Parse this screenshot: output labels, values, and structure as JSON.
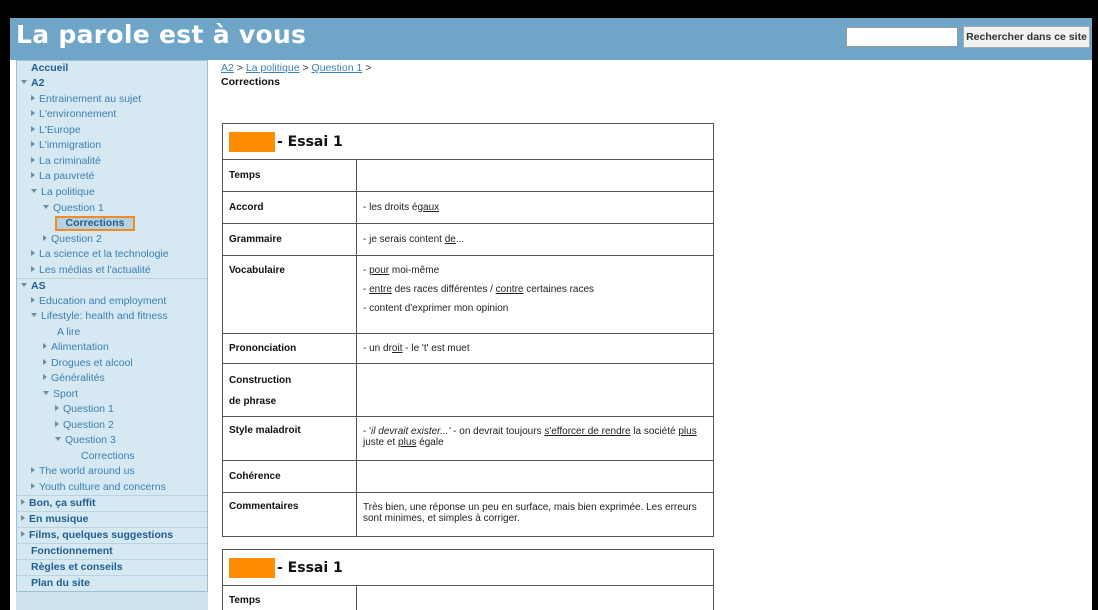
{
  "header": {
    "title": "La parole est à vous",
    "search_button": "Rechercher dans ce site",
    "search_value": ""
  },
  "sidebar": {
    "items": [
      {
        "label": "Accueil"
      },
      {
        "label": "A2"
      },
      {
        "label": "Entrainement au sujet"
      },
      {
        "label": "L'environnement"
      },
      {
        "label": "L'Europe"
      },
      {
        "label": "L'immigration"
      },
      {
        "label": "La criminalité"
      },
      {
        "label": "La pauvreté"
      },
      {
        "label": "La politique"
      },
      {
        "label": "Question 1"
      },
      {
        "label": "Corrections"
      },
      {
        "label": "Question 2"
      },
      {
        "label": "La science et la technologie"
      },
      {
        "label": "Les médias et l'actualité"
      },
      {
        "label": "AS"
      },
      {
        "label": "Education and employment"
      },
      {
        "label": "Lifestyle: health and fitness"
      },
      {
        "label": "A lire"
      },
      {
        "label": "Alimentation"
      },
      {
        "label": "Drogues et alcool"
      },
      {
        "label": "Généralités"
      },
      {
        "label": "Sport"
      },
      {
        "label": "Question 1"
      },
      {
        "label": "Question 2"
      },
      {
        "label": "Question 3"
      },
      {
        "label": "Corrections"
      },
      {
        "label": "The world around us"
      },
      {
        "label": "Youth culture and concerns"
      },
      {
        "label": "Bon, ça suffit"
      },
      {
        "label": "En musique"
      },
      {
        "label": "Films, quelques suggestions"
      },
      {
        "label": "Fonctionnement"
      },
      {
        "label": "Règles et conseils"
      },
      {
        "label": "Plan du site"
      }
    ]
  },
  "breadcrumb": {
    "items": [
      "A2",
      "La politique",
      "Question 1"
    ],
    "sep": ">"
  },
  "page_title": "Corrections",
  "essay1": {
    "title": "- Essai 1",
    "rows": {
      "temps": "Temps",
      "accord": "Accord",
      "accord_val_a": "- les droits é",
      "accord_val_b": "gaux",
      "grammaire": "Grammaire",
      "grammaire_val_a": "- je serais content ",
      "grammaire_val_b": "de",
      "grammaire_val_c": "...",
      "vocabulaire": "Vocabulaire",
      "voc1_a": "- ",
      "voc1_b": "pour",
      "voc1_c": " moi-même",
      "voc2_a": "- ",
      "voc2_b": "entre",
      "voc2_c": " des races différentes / ",
      "voc2_d": "contre",
      "voc2_e": " certaines races",
      "voc3": "- content d'exprimer mon opinion",
      "prononciation": "Prononciation",
      "pron_a": "- un dr",
      "pron_b": "oit",
      "pron_c": " - le 't' est muet",
      "construction": "Construction",
      "construction2": "de phrase",
      "style": "Style maladroit",
      "style_a": "- '",
      "style_b": "il devrait exister...'",
      "style_c": " - on devrait toujours ",
      "style_d": "s'efforcer de rendre",
      "style_e": " la société ",
      "style_f": "plus",
      "style_g": " juste et ",
      "style_h": "plus",
      "style_i": " égale",
      "coherence": "Cohérence",
      "commentaires": "Commentaires",
      "comment_val": "Très bien, une réponse un peu en surface, mais bien exprimée. Les erreurs sont minimes, et simples à corriger."
    }
  },
  "essay2": {
    "title": "- Essai 1",
    "temps": "Temps"
  },
  "colors": {
    "header": "#6fa6c8",
    "sidebar": "#d6e8f1",
    "accent": "#ff8c00",
    "link": "#3b7fb5"
  }
}
